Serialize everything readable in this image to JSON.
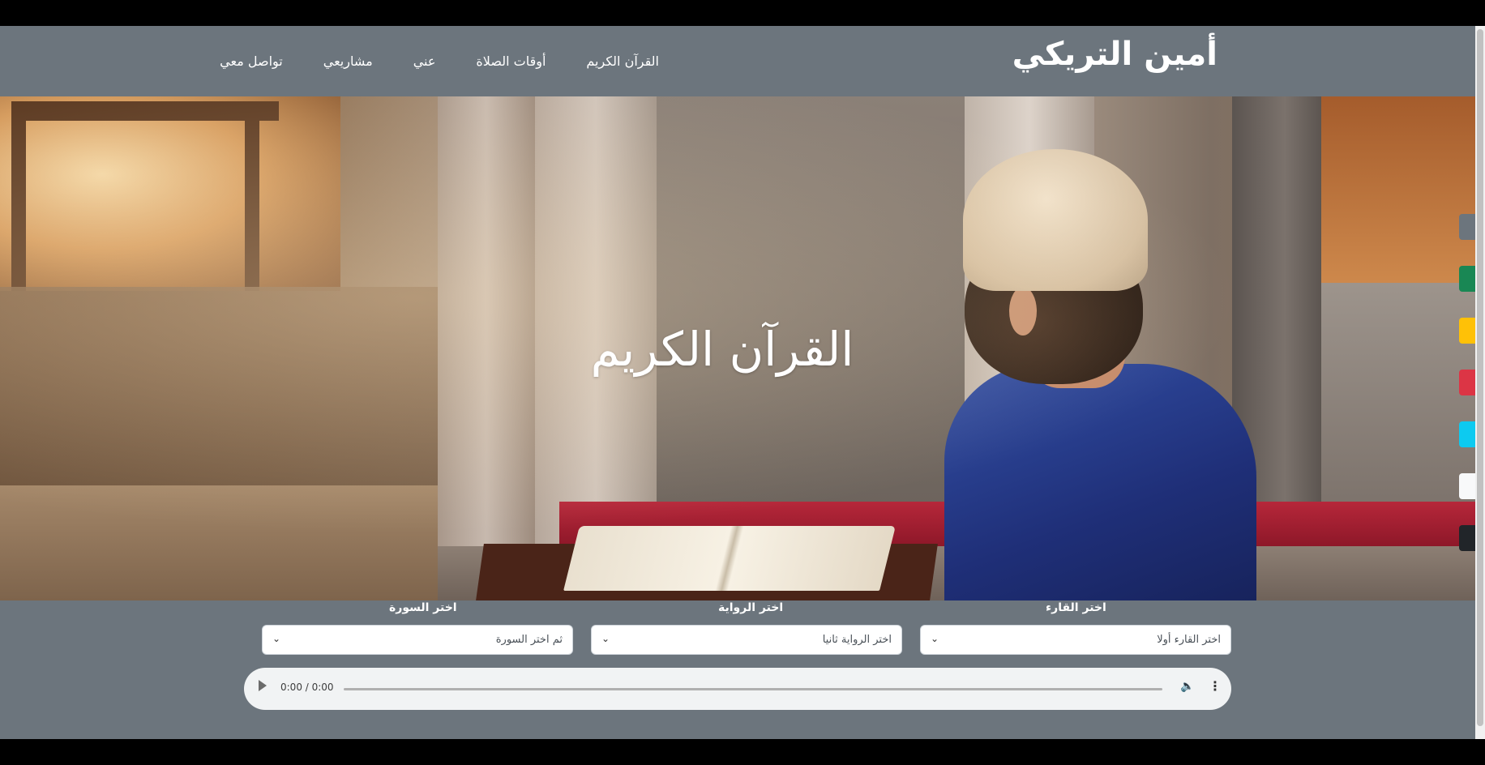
{
  "header": {
    "brand": "أمين التريكي",
    "nav": [
      "القرآن الكريم",
      "أوقات الصلاة",
      "عني",
      "مشاريعي",
      "تواصل معي"
    ]
  },
  "hero": {
    "title": "القرآن الكريم"
  },
  "color_switcher": [
    "#6c757d",
    "#198754",
    "#ffc107",
    "#dc3545",
    "#0dcaf0",
    "#f8f9fa",
    "#212529"
  ],
  "controls": {
    "reciter_label": "اختر القارء",
    "reciter_value": "اختر القارء أولا",
    "narration_label": "اختر الرواية",
    "narration_value": "اختر الرواية ثانيا",
    "surah_label": "اختر السورة",
    "surah_value": "ثم اختر السورة"
  },
  "audio": {
    "time": "0:00 / 0:00"
  }
}
